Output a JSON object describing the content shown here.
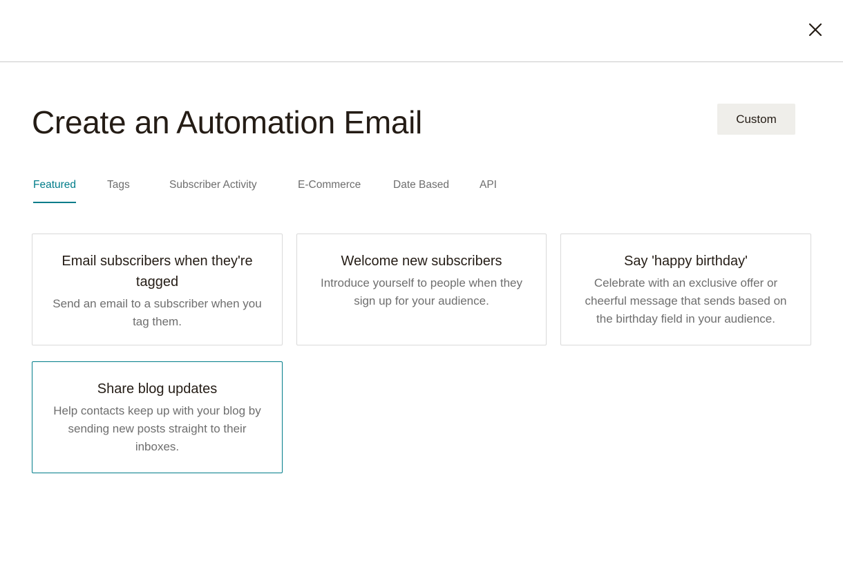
{
  "header": {
    "close_icon": "close-icon",
    "close_glyph": "✕"
  },
  "page": {
    "title": "Create an Automation Email",
    "custom_label": "Custom"
  },
  "tabs": [
    {
      "label": "Featured",
      "active": true
    },
    {
      "label": "Tags",
      "active": false
    },
    {
      "label": "Subscriber Activity",
      "active": false
    },
    {
      "label": "E-Commerce",
      "active": false
    },
    {
      "label": "Date Based",
      "active": false
    },
    {
      "label": "API",
      "active": false
    }
  ],
  "cards": [
    {
      "title": "Email subscribers when they're tagged",
      "description": "Send an email to a subscriber when you tag them.",
      "selected": false
    },
    {
      "title": "Welcome new subscribers",
      "description": "Introduce yourself to people when they sign up for your audience.",
      "selected": false
    },
    {
      "title": "Say 'happy birthday'",
      "description": "Celebrate with an exclusive offer or cheerful message that sends based on the birthday field in your audience.",
      "selected": false
    },
    {
      "title": "Share blog updates",
      "description": "Help contacts keep up with your blog by sending new posts straight to their inboxes.",
      "selected": true
    }
  ],
  "colors": {
    "accent": "#007c89",
    "text": "#241c15",
    "muted": "#6e6e6e",
    "border": "#d9d9d9",
    "button_bg": "#efeeea"
  }
}
